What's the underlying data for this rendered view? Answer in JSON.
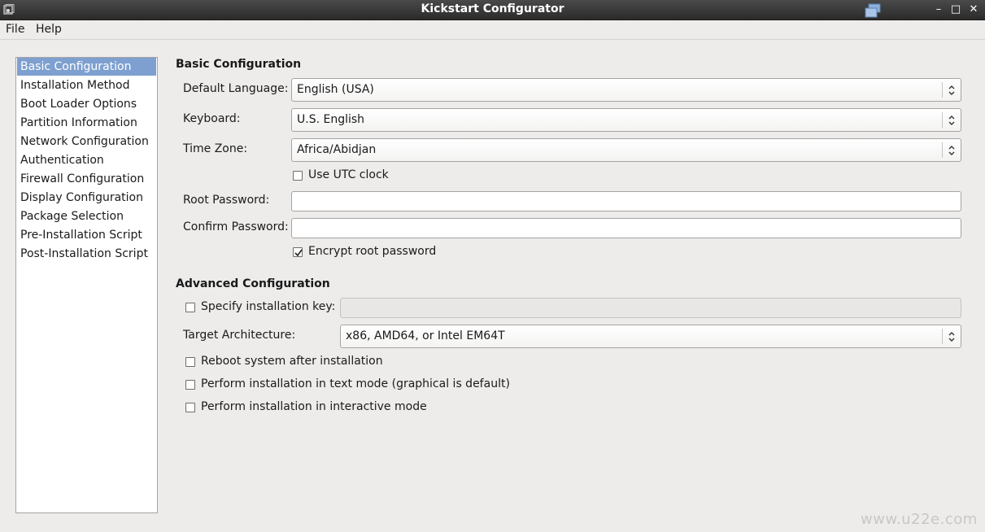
{
  "window": {
    "title": "Kickstart Configurator",
    "controls": {
      "minimize": "–",
      "maximize": "□",
      "close": "✕"
    }
  },
  "menubar": {
    "items": [
      "File",
      "Help"
    ]
  },
  "sidebar": {
    "selected_index": 0,
    "items": [
      "Basic Configuration",
      "Installation Method",
      "Boot Loader Options",
      "Partition Information",
      "Network Configuration",
      "Authentication",
      "Firewall Configuration",
      "Display Configuration",
      "Package Selection",
      "Pre-Installation Script",
      "Post-Installation Script"
    ]
  },
  "basic": {
    "section_title": "Basic Configuration",
    "default_language": {
      "label": "Default Language:",
      "value": "English (USA)"
    },
    "keyboard": {
      "label": "Keyboard:",
      "value": "U.S. English"
    },
    "time_zone": {
      "label": "Time Zone:",
      "value": "Africa/Abidjan"
    },
    "utc_clock": {
      "label": "Use UTC clock",
      "checked": false
    },
    "root_password": {
      "label": "Root Password:",
      "value": ""
    },
    "confirm_password": {
      "label": "Confirm Password:",
      "value": ""
    },
    "encrypt_root": {
      "label": "Encrypt root password",
      "checked": true
    }
  },
  "advanced": {
    "section_title": "Advanced Configuration",
    "installation_key": {
      "label": "Specify installation key:",
      "checked": false,
      "value": ""
    },
    "target_arch": {
      "label": "Target Architecture:",
      "value": "x86, AMD64, or Intel EM64T"
    },
    "reboot": {
      "label": "Reboot system after installation",
      "checked": false
    },
    "text_mode": {
      "label": "Perform installation in text mode (graphical is default)",
      "checked": false
    },
    "interactive": {
      "label": "Perform installation in interactive mode",
      "checked": false
    }
  },
  "watermark": "www.u22e.com",
  "colors": {
    "titlebar": "#2b2b2b",
    "selection": "#7ea0d0",
    "window_bg": "#edeceb"
  }
}
